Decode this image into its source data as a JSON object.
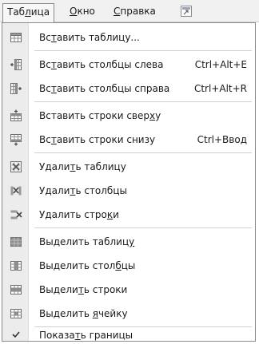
{
  "menubar": {
    "items": [
      {
        "pre": "Таб",
        "u": "л",
        "post": "ица"
      },
      {
        "pre": "",
        "u": "О",
        "post": "кно"
      },
      {
        "pre": "",
        "u": "С",
        "post": "правка"
      }
    ],
    "extra_icon": "window-icon"
  },
  "menu": {
    "items": [
      {
        "pre": "Вс",
        "u": "т",
        "post": "авить таблицу...",
        "shortcut": "",
        "icon": "insert-table-icon"
      },
      {
        "pre": "Вс",
        "u": "т",
        "post": "авить столбцы слева",
        "shortcut": "Ctrl+Alt+E",
        "icon": "insert-columns-left-icon"
      },
      {
        "pre": "Вс",
        "u": "т",
        "post": "авить столбцы справа",
        "shortcut": "Ctrl+Alt+R",
        "icon": "insert-columns-right-icon"
      },
      {
        "pre": "Вставить строки свер",
        "u": "х",
        "post": "у",
        "shortcut": "",
        "icon": "insert-rows-above-icon"
      },
      {
        "pre": "Вс",
        "u": "т",
        "post": "авить строки снизу",
        "shortcut": "Ctrl+Ввод",
        "icon": "insert-rows-below-icon"
      },
      {
        "pre": "Удали",
        "u": "т",
        "post": "ь таблицу",
        "shortcut": "",
        "icon": "delete-table-icon"
      },
      {
        "pre": "Удали",
        "u": "т",
        "post": "ь столбцы",
        "shortcut": "",
        "icon": "delete-columns-icon"
      },
      {
        "pre": "Удалить стро",
        "u": "к",
        "post": "и",
        "shortcut": "",
        "icon": "delete-rows-icon"
      },
      {
        "pre": "Выделить таблиц",
        "u": "у",
        "post": "",
        "shortcut": "",
        "icon": "select-table-icon"
      },
      {
        "pre": "Выделить стол",
        "u": "б",
        "post": "цы",
        "shortcut": "",
        "icon": "select-columns-icon"
      },
      {
        "pre": "Выдели",
        "u": "т",
        "post": "ь строки",
        "shortcut": "",
        "icon": "select-rows-icon"
      },
      {
        "pre": "Выделить ",
        "u": "я",
        "post": "чейку",
        "shortcut": "",
        "icon": "select-cell-icon"
      },
      {
        "pre": "Показа",
        "u": "т",
        "post": "ь границы",
        "shortcut": "",
        "icon": "checkmark-icon"
      }
    ]
  }
}
